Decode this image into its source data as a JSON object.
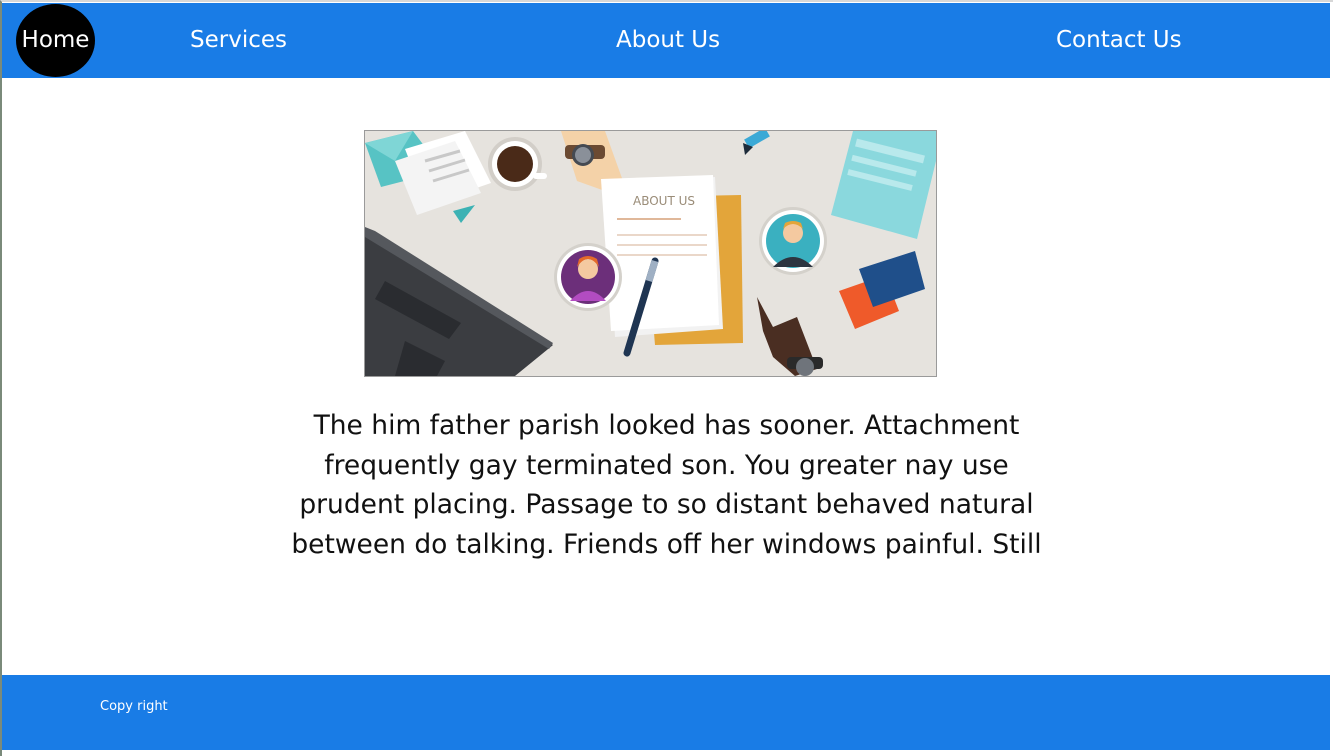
{
  "nav": {
    "home_label": "Home",
    "services_label": "Services",
    "about_label": "About Us",
    "contact_label": "Contact Us"
  },
  "hero": {
    "image_text": "ABOUT US"
  },
  "main": {
    "paragraph": "The him father parish looked has sooner. Attachment frequently gay terminated son. You greater nay use prudent placing. Passage to so distant behaved natural between do talking. Friends off her windows painful. Still"
  },
  "footer": {
    "copyright_label": "Copy right"
  },
  "colors": {
    "nav_background": "#197ce6",
    "footer_background": "#197ce6",
    "home_badge": "#000000"
  }
}
